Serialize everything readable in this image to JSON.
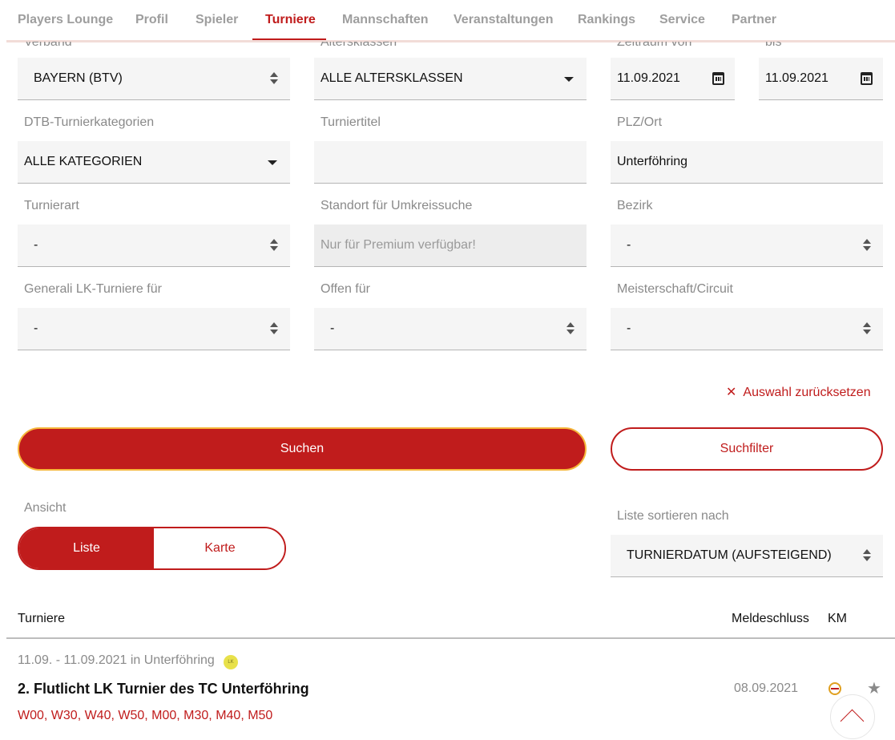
{
  "nav": {
    "items": [
      {
        "label": "Players Lounge"
      },
      {
        "label": "Profil"
      },
      {
        "label": "Spieler"
      },
      {
        "label": "Turniere"
      },
      {
        "label": "Mannschaften"
      },
      {
        "label": "Veranstaltungen"
      },
      {
        "label": "Rankings"
      },
      {
        "label": "Service"
      },
      {
        "label": "Partner"
      }
    ],
    "active": "Turniere"
  },
  "filters": {
    "verband": {
      "label": "Verband",
      "value": "BAYERN (BTV)"
    },
    "altersklassen": {
      "label": "Altersklassen",
      "value": "ALLE ALTERSKLASSEN"
    },
    "zeitraum_von": {
      "label": "Zeitraum von",
      "value": "11.09.2021"
    },
    "bis": {
      "label": "bis",
      "value": "11.09.2021"
    },
    "kategorien": {
      "label": "DTB-Turnierkategorien",
      "value": "ALLE KATEGORIEN"
    },
    "turniertitel": {
      "label": "Turniertitel",
      "value": ""
    },
    "plz_ort": {
      "label": "PLZ/Ort",
      "value": "Unterföhring"
    },
    "turnierart": {
      "label": "Turnierart",
      "value": "-"
    },
    "standort": {
      "label": "Standort für Umkreissuche",
      "placeholder": "Nur für Premium verfügbar!"
    },
    "bezirk": {
      "label": "Bezirk",
      "value": "-"
    },
    "lk_turniere": {
      "label": "Generali LK-Turniere für",
      "value": "-"
    },
    "offen_fuer": {
      "label": "Offen für",
      "value": "-"
    },
    "meisterschaft": {
      "label": "Meisterschaft/Circuit",
      "value": "-"
    }
  },
  "actions": {
    "reset_label": "Auswahl zurücksetzen",
    "search_label": "Suchen",
    "filter_label": "Suchfilter"
  },
  "view": {
    "label": "Ansicht",
    "options": [
      "Liste",
      "Karte"
    ],
    "selected": "Liste"
  },
  "sort": {
    "label": "Liste sortieren nach",
    "value": "TURNIERDATUM (AUFSTEIGEND)"
  },
  "table": {
    "headers": {
      "tournaments": "Turniere",
      "deadline": "Meldeschluss",
      "km": "KM"
    },
    "rows": [
      {
        "date_place": "11.09. - 11.09.2021 in Unterföhring",
        "badge": "LK",
        "title": "2. Flutlicht LK Turnier des TC Unterföhring",
        "classes": "W00, W30, W40, W50, M00, M30, M40, M50",
        "deadline": "08.09.2021"
      }
    ]
  },
  "colors": {
    "accent": "#c01c1c",
    "highlight": "#f5b63a",
    "muted": "#8a8a8a"
  }
}
